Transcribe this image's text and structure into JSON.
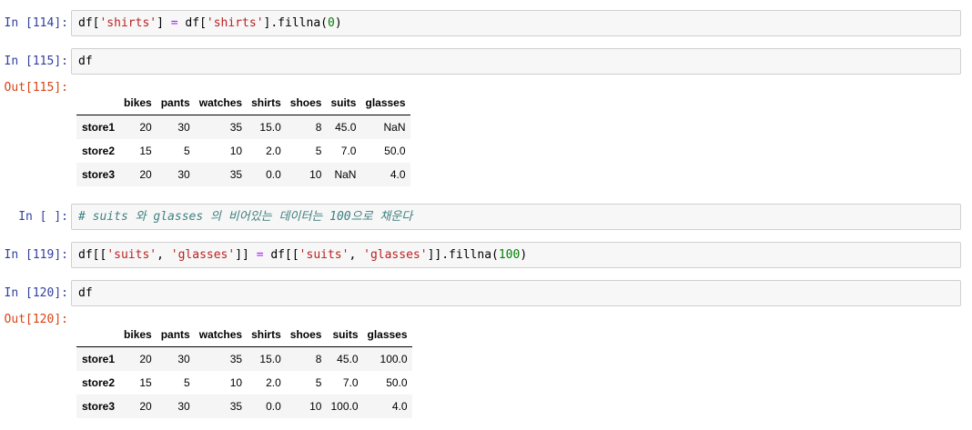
{
  "cells": {
    "c1": {
      "prompt": "In [114]:",
      "code": [
        {
          "t": "df[",
          "k": "kw"
        },
        {
          "t": "'shirts'",
          "k": "str"
        },
        {
          "t": "] ",
          "k": "kw"
        },
        {
          "t": "=",
          "k": "op"
        },
        {
          "t": " df[",
          "k": "kw"
        },
        {
          "t": "'shirts'",
          "k": "str"
        },
        {
          "t": "].fillna(",
          "k": "kw"
        },
        {
          "t": "0",
          "k": "num"
        },
        {
          "t": ")",
          "k": "kw"
        }
      ]
    },
    "c2": {
      "prompt": "In [115]:",
      "code": [
        {
          "t": "df",
          "k": "kw"
        }
      ],
      "out_prompt": "Out[115]:"
    },
    "c3": {
      "prompt": "In [ ]:",
      "code": [
        {
          "t": "# suits 와 glasses 의 비어있는 데이터는 100으로 채운다",
          "k": "cmt"
        }
      ]
    },
    "c4": {
      "prompt": "In [119]:",
      "code": [
        {
          "t": "df[[",
          "k": "kw"
        },
        {
          "t": "'suits'",
          "k": "str"
        },
        {
          "t": ", ",
          "k": "kw"
        },
        {
          "t": "'glasses'",
          "k": "str"
        },
        {
          "t": "]] ",
          "k": "kw"
        },
        {
          "t": "=",
          "k": "op"
        },
        {
          "t": " df[[",
          "k": "kw"
        },
        {
          "t": "'suits'",
          "k": "str"
        },
        {
          "t": ", ",
          "k": "kw"
        },
        {
          "t": "'glasses'",
          "k": "str"
        },
        {
          "t": "]].fillna(",
          "k": "kw"
        },
        {
          "t": "100",
          "k": "num"
        },
        {
          "t": ")",
          "k": "kw"
        }
      ]
    },
    "c5": {
      "prompt": "In [120]:",
      "code": [
        {
          "t": "df",
          "k": "kw"
        }
      ],
      "out_prompt": "Out[120]:"
    }
  },
  "table1": {
    "columns": [
      "",
      "bikes",
      "pants",
      "watches",
      "shirts",
      "shoes",
      "suits",
      "glasses"
    ],
    "rows": [
      [
        "store1",
        "20",
        "30",
        "35",
        "15.0",
        "8",
        "45.0",
        "NaN"
      ],
      [
        "store2",
        "15",
        "5",
        "10",
        "2.0",
        "5",
        "7.0",
        "50.0"
      ],
      [
        "store3",
        "20",
        "30",
        "35",
        "0.0",
        "10",
        "NaN",
        "4.0"
      ]
    ]
  },
  "table2": {
    "columns": [
      "",
      "bikes",
      "pants",
      "watches",
      "shirts",
      "shoes",
      "suits",
      "glasses"
    ],
    "rows": [
      [
        "store1",
        "20",
        "30",
        "35",
        "15.0",
        "8",
        "45.0",
        "100.0"
      ],
      [
        "store2",
        "15",
        "5",
        "10",
        "2.0",
        "5",
        "7.0",
        "50.0"
      ],
      [
        "store3",
        "20",
        "30",
        "35",
        "0.0",
        "10",
        "100.0",
        "4.0"
      ]
    ]
  }
}
